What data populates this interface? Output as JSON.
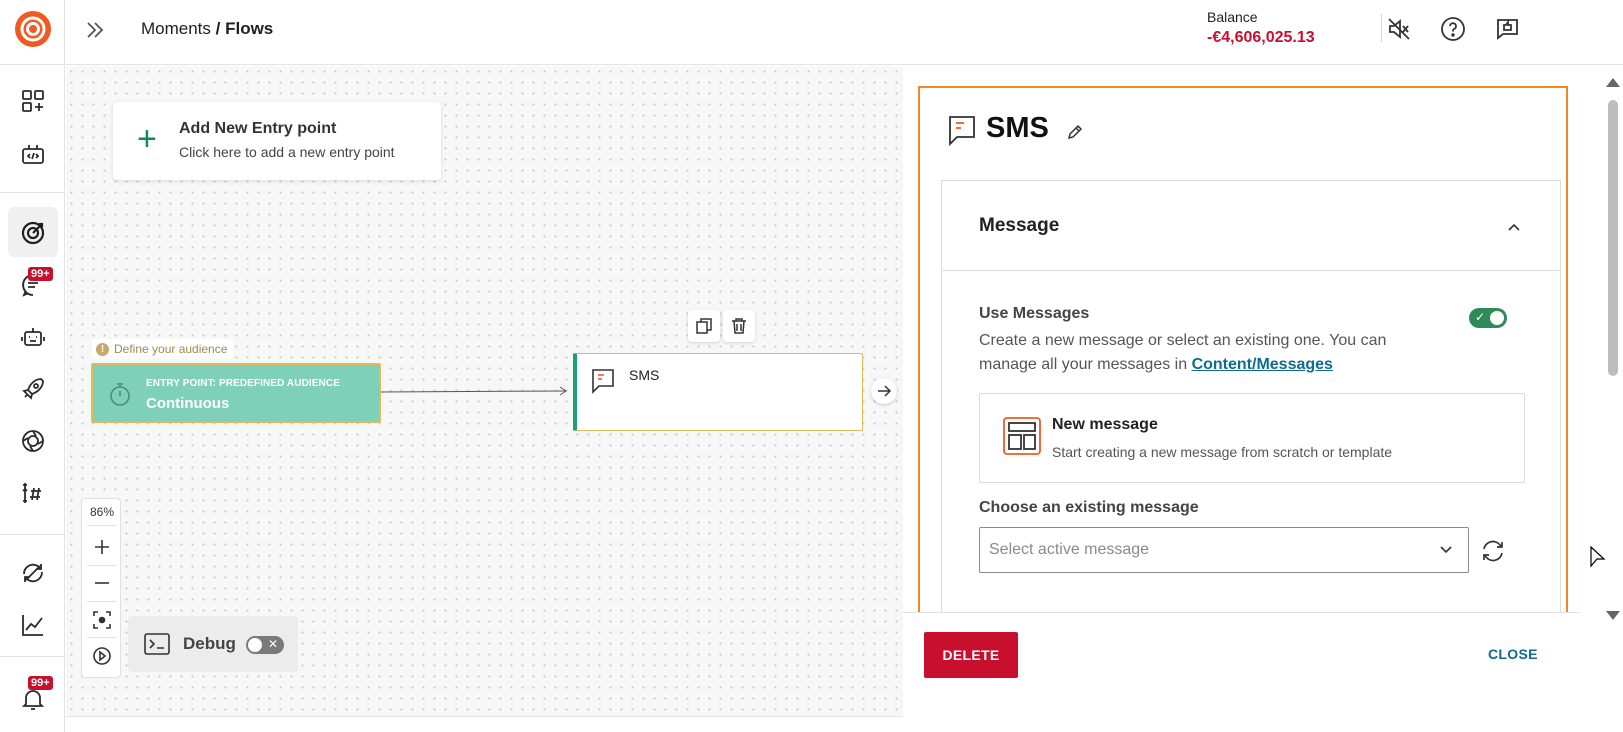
{
  "header": {
    "breadcrumb_parent": "Moments",
    "breadcrumb_sep": " / ",
    "breadcrumb_current": "Flows",
    "balance_label": "Balance",
    "balance_value": "-€4,606,025.13"
  },
  "sidebar": {
    "badges": {
      "chat": "99+",
      "notifications": "99+"
    },
    "icons": [
      "apps-add-icon",
      "code-box-icon",
      "target-icon",
      "chat-icon",
      "bot-icon",
      "rocket-icon",
      "aperture-icon",
      "hashtag-icon",
      "sync-off-icon",
      "analytics-icon",
      "bell-icon"
    ]
  },
  "canvas": {
    "add_entry_title": "Add New Entry point",
    "add_entry_desc": "Click here to add a new entry point",
    "audience_hint": "Define your audience",
    "entry_node_type": "ENTRY POINT: PREDEFINED AUDIENCE",
    "entry_node_name": "Continuous",
    "sms_node_name": "SMS",
    "zoom": "86%",
    "debug_label": "Debug"
  },
  "panel": {
    "title": "SMS",
    "section_title": "Message",
    "use_messages_title": "Use Messages",
    "use_messages_desc": "Create a new message or select an existing one. You can manage all your messages in ",
    "use_messages_link": "Content/Messages",
    "new_message_title": "New message",
    "new_message_desc": "Start creating a new message from scratch or template",
    "choose_label": "Choose an existing message",
    "select_placeholder": "Select active message",
    "delete_label": "DELETE",
    "close_label": "CLOSE"
  },
  "colors": {
    "brand": "#f05a22",
    "danger": "#c8102e",
    "accent_green": "#2e8b57",
    "panel_focus": "#f08a1c",
    "link": "#0f6b8f"
  }
}
